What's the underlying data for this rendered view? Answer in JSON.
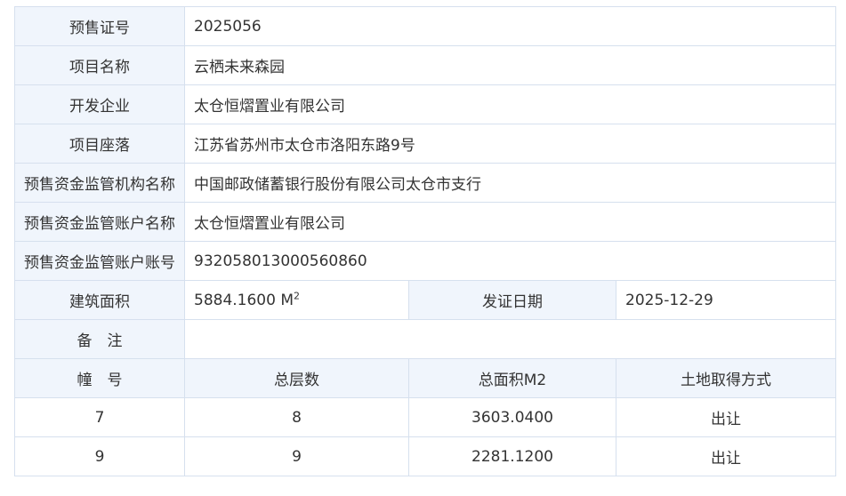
{
  "presale_license_label": "预售证号",
  "presale_license_value": "2025056",
  "project_name_label": "项目名称",
  "project_name_value": "云栖未来森园",
  "developer_label": "开发企业",
  "developer_value": "太仓恒熠置业有限公司",
  "location_label": "项目座落",
  "location_value": "江苏省苏州市太仓市洛阳东路9号",
  "supervisor_org_label": "预售资金监管机构名称",
  "supervisor_org_value": "中国邮政储蓄银行股份有限公司太仓市支行",
  "account_name_label": "预售资金监管账户名称",
  "account_name_value": "太仓恒熠置业有限公司",
  "account_number_label": "预售资金监管账户账号",
  "account_number_value": "932058013000560860",
  "area_label": "建筑面积",
  "area_value": "5884.1600 M",
  "area_unit_sup": "2",
  "issue_date_label": "发证日期",
  "issue_date_value": "2025-12-29",
  "remark_label": "备　注",
  "remark_value": "",
  "buildings": {
    "headers": [
      "幢　号",
      "总层数",
      "总面积M2",
      "土地取得方式"
    ],
    "rows": [
      [
        "7",
        "8",
        "3603.0400",
        "出让"
      ],
      [
        "9",
        "9",
        "2281.1200",
        "出让"
      ]
    ]
  }
}
